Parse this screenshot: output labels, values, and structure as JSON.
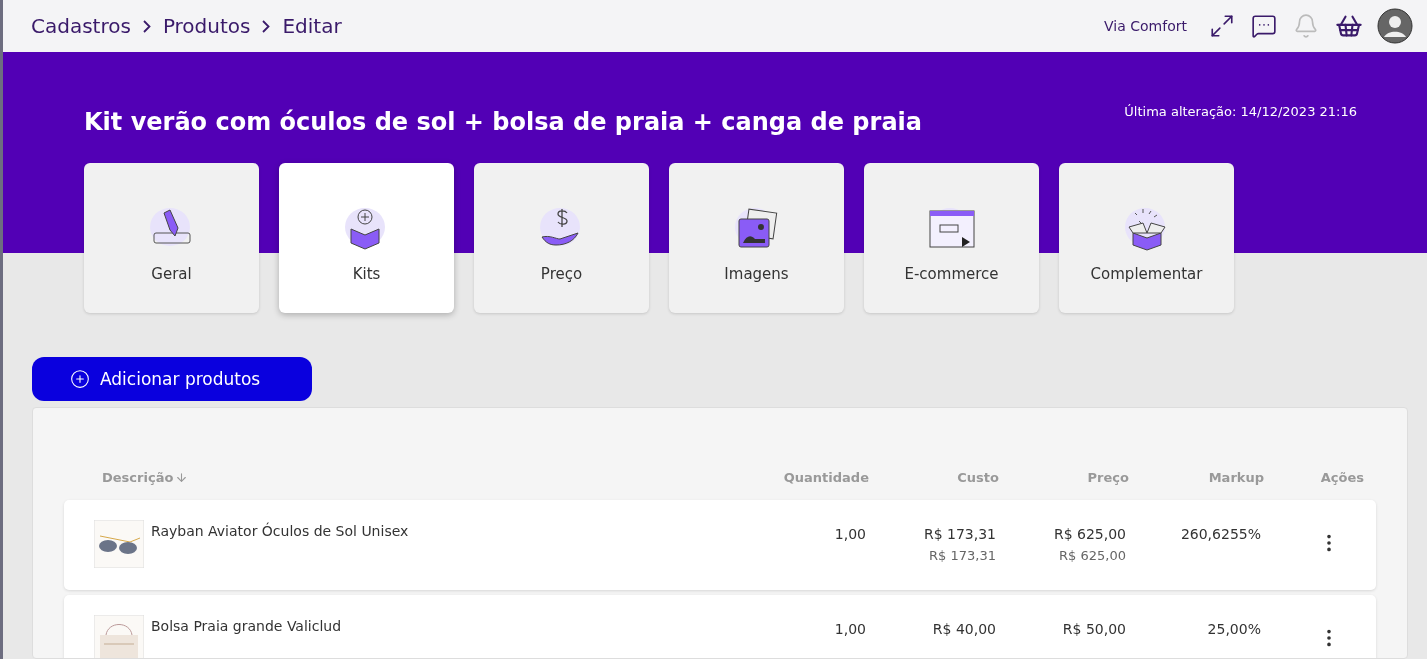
{
  "breadcrumb": [
    "Cadastros",
    "Produtos",
    "Editar"
  ],
  "topbar": {
    "company": "Via Comfort"
  },
  "header": {
    "title": "Kit verão com óculos de sol + bolsa de praia + canga de praia",
    "last_change": "Última alteração: 14/12/2023 21:16"
  },
  "tabs": [
    {
      "label": "Geral",
      "kind": "pencil",
      "selected": false
    },
    {
      "label": "Kits",
      "kind": "box",
      "selected": true
    },
    {
      "label": "Preço",
      "kind": "money",
      "selected": false
    },
    {
      "label": "Imagens",
      "kind": "images",
      "selected": false
    },
    {
      "label": "E-commerce",
      "kind": "web",
      "selected": false
    },
    {
      "label": "Complementar",
      "kind": "gift",
      "selected": false
    }
  ],
  "add_button": "Adicionar produtos",
  "table": {
    "columns": [
      "Descrição",
      "Quantidade",
      "Custo",
      "Preço",
      "Markup",
      "Ações"
    ],
    "rows": [
      {
        "description": "Rayban Aviator Óculos de Sol Unisex",
        "quantity": "1,00",
        "cost": "R$ 173,31",
        "cost_sub": "R$ 173,31",
        "price": "R$ 625,00",
        "price_sub": "R$ 625,00",
        "markup": "260,6255%"
      },
      {
        "description": "Bolsa Praia grande Valiclud",
        "quantity": "1,00",
        "cost": "R$ 40,00",
        "price": "R$ 50,00",
        "markup": "25,00%"
      }
    ]
  }
}
